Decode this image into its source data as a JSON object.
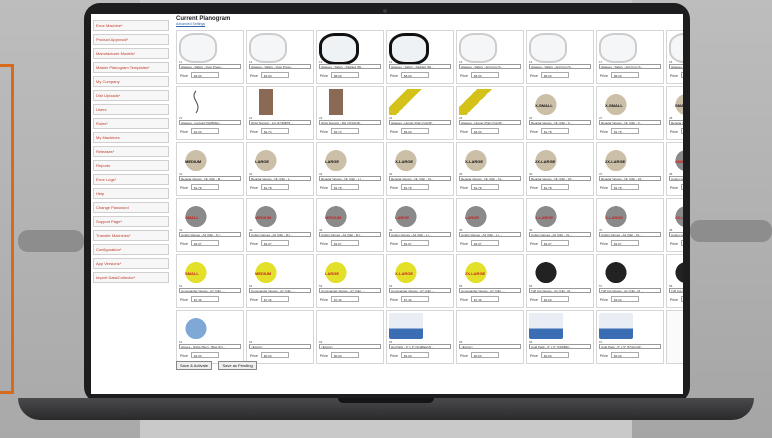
{
  "sidebar": {
    "items": [
      "Error Machine*",
      "Product Approval*",
      "Manufacturer Models*",
      "Master Planogram Templates*",
      "My Company",
      "Dist Uploads*",
      "Users",
      "Roles*",
      "My Machines",
      "Releases*",
      "Reports",
      "Error Logs*",
      "Help",
      "Change Password",
      "Support Page*",
      "Transfer Machines*",
      "Configuration*",
      "App Versions*",
      "Import Data/Collector*"
    ]
  },
  "header": {
    "title": "Current Planogram",
    "subtitle": "Advanced Settings"
  },
  "planogram": {
    "cells": [
      {
        "num": "11",
        "name": "Glasses - Safety - Over Preso...",
        "price": "$3.00",
        "kind": "glasses-clear"
      },
      {
        "num": "12",
        "name": "Glasses - Safety - Over Preso...",
        "price": "$3.00",
        "kind": "glasses-clear"
      },
      {
        "num": "13",
        "name": "Glasses - Safety - Padded (Mi...",
        "price": "$8.00",
        "kind": "glasses-black"
      },
      {
        "num": "14",
        "name": "Glasses - Safety - Padded (Mi...",
        "price": "$8.00",
        "kind": "glasses-black"
      },
      {
        "num": "15",
        "name": "Glasses - Safety - Anti Fog (S...",
        "price": "$5.00",
        "kind": "glasses-clear"
      },
      {
        "num": "16",
        "name": "Glasses - Safety - Anti Fog (S...",
        "price": "$5.00",
        "kind": "glasses-clear"
      },
      {
        "num": "17",
        "name": "Glasses - Safety - Anti Fog (S...",
        "price": "$5.00",
        "kind": "glasses-clear"
      },
      {
        "num": "18",
        "name": "Glasses - Safety",
        "price": "$5.0",
        "kind": "glasses-clear"
      },
      {
        "num": "21",
        "name": "Glasses - Lanyard (GR86Da...",
        "price": "$1.00",
        "kind": "lanyard"
      },
      {
        "num": "22",
        "name": "Wrist Support - LG (474DB78...",
        "price": "$4.74",
        "kind": "wrist"
      },
      {
        "num": "23",
        "name": "Wrist Support - RH (474xbxB...",
        "price": "$4.74",
        "kind": "wrist"
      },
      {
        "num": "24",
        "name": "Glasses - Hunter (Pair) (GLNP...",
        "price": "$6.00",
        "kind": "pad-yellow"
      },
      {
        "num": "25",
        "name": "Glasses - Hunter (Pair) (GLNP...",
        "price": "$4.00",
        "kind": "pad-yellow"
      },
      {
        "num": "26",
        "name": "Regular Gloves - NL (CE) - X...",
        "price": "$1.78",
        "kind": "glove-beige",
        "tag": "X-SMALL"
      },
      {
        "num": "27",
        "name": "Regular Gloves - NL (CE) - X...",
        "price": "$1.78",
        "kind": "glove-beige",
        "tag": "X-SMALL"
      },
      {
        "num": "28",
        "name": "Regular Gloves -",
        "price": "$1.7",
        "kind": "glove-beige",
        "tag": "SMALL"
      },
      {
        "num": "31",
        "name": "Regular Gloves - NL (CE) - M...",
        "price": "$1.78",
        "kind": "glove-beige",
        "tag": "MEDIUM"
      },
      {
        "num": "32",
        "name": "Regular Gloves - NL (CE) - L...",
        "price": "$1.78",
        "kind": "glove-beige",
        "tag": "LARGE"
      },
      {
        "num": "33",
        "name": "Regular Gloves - NL (CE) - L (...",
        "price": "$1.78",
        "kind": "glove-beige",
        "tag": "LARGE"
      },
      {
        "num": "34",
        "name": "Regular Gloves - NL (CE) - XL...",
        "price": "$1.78",
        "kind": "glove-beige",
        "tag": "X-LARGE"
      },
      {
        "num": "35",
        "name": "Regular Gloves - NL (CE) - XL...",
        "price": "$1.78",
        "kind": "glove-beige",
        "tag": "X-LARGE"
      },
      {
        "num": "36",
        "name": "Regular Gloves - NL (CE) - 2X...",
        "price": "$1.78",
        "kind": "glove-beige",
        "tag": "2X-LARGE"
      },
      {
        "num": "37",
        "name": "Regular Gloves - NL (CE) - 2X...",
        "price": "$1.78",
        "kind": "glove-beige",
        "tag": "2X-LARGE"
      },
      {
        "num": "38",
        "name": "Cotton Gloves -",
        "price": "$3.0",
        "kind": "glove-grey",
        "tag": "SMALL",
        "red": true
      },
      {
        "num": "41",
        "name": "Cotton Gloves - A2 (CE) - S (...",
        "price": "$3.07",
        "kind": "glove-grey",
        "tag": "SMALL",
        "red": true
      },
      {
        "num": "42",
        "name": "Cotton Gloves - A2 (CE) - M (...",
        "price": "$3.07",
        "kind": "glove-grey",
        "tag": "MEDIUM",
        "red": true
      },
      {
        "num": "43",
        "name": "Cotton Gloves - A2 (CE) - M (...",
        "price": "$3.07",
        "kind": "glove-grey",
        "tag": "MEDIUM",
        "red": true
      },
      {
        "num": "44",
        "name": "Cotton Gloves - A2 (CE) - L (...",
        "price": "$3.07",
        "kind": "glove-grey",
        "tag": "LARGE",
        "red": true
      },
      {
        "num": "45",
        "name": "Cotton Gloves - A2 (CE) - L (...",
        "price": "$3.07",
        "kind": "glove-grey",
        "tag": "LARGE",
        "red": true
      },
      {
        "num": "46",
        "name": "Cotton Gloves - A2 (CE) - XL ...",
        "price": "$3.07",
        "kind": "glove-grey",
        "tag": "X-LARGE",
        "red": true
      },
      {
        "num": "47",
        "name": "Cotton Gloves - A2 (CE) - XL ...",
        "price": "$3.07",
        "kind": "glove-grey",
        "tag": "X-LARGE",
        "red": true
      },
      {
        "num": "48",
        "name": "Cotton Gloves -",
        "price": "$3.0",
        "kind": "glove-grey",
        "tag": "2X-LARGE",
        "red": true
      },
      {
        "num": "51",
        "name": "Commander Gloves - A7 (CE) -...",
        "price": "$7.46",
        "kind": "glove-yellow",
        "tag": "SMALL",
        "red": true
      },
      {
        "num": "52",
        "name": "Commander Gloves - A7 (CE) -...",
        "price": "$7.46",
        "kind": "glove-yellow",
        "tag": "MEDIUM",
        "red": true
      },
      {
        "num": "53",
        "name": "Commander Gloves - A7 (CE) -...",
        "price": "$7.46",
        "kind": "glove-yellow",
        "tag": "LARGE",
        "red": true
      },
      {
        "num": "54",
        "name": "Commander Gloves - A7 (CE) -...",
        "price": "$7.46",
        "kind": "glove-yellow",
        "tag": "X-LARGE",
        "red": true
      },
      {
        "num": "55",
        "name": "Commander Gloves - A7 (CE) -...",
        "price": "$7.46",
        "kind": "glove-yellow",
        "tag": "2X-LARGE",
        "red": true
      },
      {
        "num": "56",
        "name": "Tuff Cut Gloves - A1 (CE) - M...",
        "price": "$3.60",
        "kind": "glove-black"
      },
      {
        "num": "57",
        "name": "Tuff Cut Gloves - A1 (CE) - M ...",
        "price": "$3.60",
        "kind": "glove-black"
      },
      {
        "num": "58",
        "name": "Tuff Cut Gloves -",
        "price": "$3.6",
        "kind": "glove-black"
      },
      {
        "num": "61",
        "name": "Gloves - Nitrile (Box) - Blue NO...",
        "price": "$2.00",
        "kind": "glove-blue"
      },
      {
        "num": "62",
        "name": "<Empty>",
        "price": "$0.00",
        "kind": "empty"
      },
      {
        "num": "63",
        "name": "<Empty>",
        "price": "$0.00",
        "kind": "empty"
      },
      {
        "num": "64",
        "name": "Hot Pack - 6\" x 9\" (Scdl8auhN...",
        "price": "$2.00",
        "kind": "kit"
      },
      {
        "num": "65",
        "name": "<Empty>",
        "price": "$0.00",
        "kind": "empty"
      },
      {
        "num": "66",
        "name": "Cold Pack - 6\" x 9\" (C6DB4F...",
        "price": "$2.00",
        "kind": "kit"
      },
      {
        "num": "67",
        "name": "Cold Pack - 6\" x 9\" (674mmtP...",
        "price": "$2.00",
        "kind": "kit"
      },
      {
        "num": "",
        "name": "",
        "price": "",
        "kind": "blank"
      }
    ],
    "price_label": "Price"
  },
  "footer": {
    "save_activate": "Save & Activate",
    "save_pending": "Save as Pending"
  },
  "colors": {
    "accent": "#d86a1c",
    "link_red": "#c0392b"
  }
}
